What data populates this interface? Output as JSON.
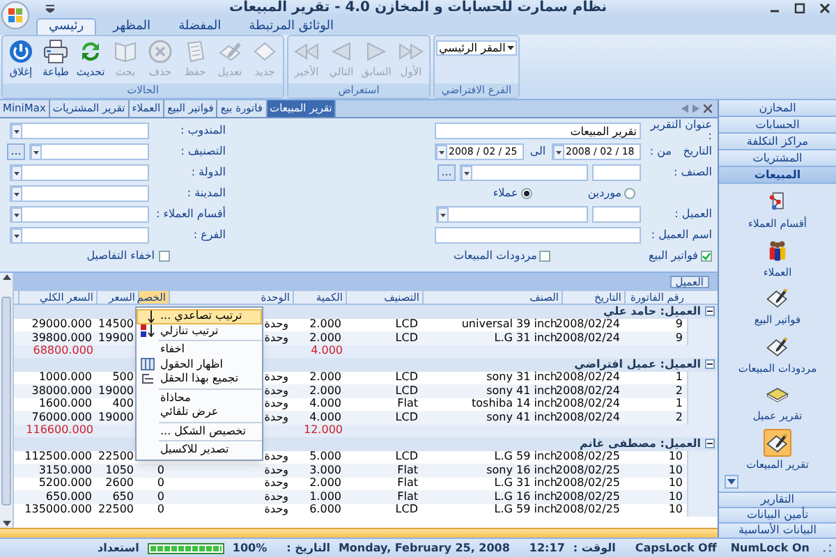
{
  "window": {
    "title": "نظام سمارت للحسابات و المخازن 4.0 - تقرير المبيعات"
  },
  "ribbon": {
    "tabs": [
      {
        "label": "الوثائق المرتبطة",
        "selected": false
      },
      {
        "label": "المفضلة",
        "selected": false
      },
      {
        "label": "المظهر",
        "selected": false
      },
      {
        "label": "رئيسي",
        "selected": true
      }
    ],
    "groups": [
      {
        "kind": "dropdown",
        "title": "الفرع الافتراضي",
        "value": "المقر الرئيسي"
      },
      {
        "kind": "buttons",
        "title": "استعراض",
        "buttons": [
          {
            "kind": "first",
            "label": "الأول",
            "disabled": true
          },
          {
            "kind": "previous",
            "label": "السابق",
            "disabled": true
          },
          {
            "kind": "next",
            "label": "التالي",
            "disabled": true
          },
          {
            "kind": "last",
            "label": "الأخير",
            "disabled": true
          }
        ]
      },
      {
        "kind": "buttons",
        "title": "الحالات",
        "buttons": [
          {
            "kind": "new",
            "label": "جديد",
            "disabled": true
          },
          {
            "kind": "edit",
            "label": "تعديل",
            "disabled": true
          },
          {
            "kind": "save",
            "label": "حفظ",
            "disabled": true
          },
          {
            "kind": "delete",
            "label": "حذف",
            "disabled": true
          },
          {
            "kind": "search",
            "label": "بحث",
            "disabled": true
          },
          {
            "kind": "refresh",
            "label": "تحديث",
            "disabled": false
          },
          {
            "kind": "print",
            "label": "طباعة",
            "disabled": false
          },
          {
            "kind": "power",
            "label": "إغلاق",
            "disabled": false
          }
        ]
      }
    ]
  },
  "document_tabs": [
    {
      "label": "تقرير المبيعات",
      "selected": true
    },
    {
      "label": "فاتورة بيع",
      "selected": false
    },
    {
      "label": "فواتير البيع",
      "selected": false
    },
    {
      "label": "العملاء",
      "selected": false
    },
    {
      "label": "تقرير المشتريات",
      "selected": false
    },
    {
      "label": "MiniMax",
      "selected": false
    }
  ],
  "form": {
    "title_field": {
      "label": "عنوان التقرير :",
      "value": "تقرير المبيعات"
    },
    "date_range": {
      "label": "التاريخ",
      "from_label": "من :",
      "from": "2008 / 02 / 18",
      "to_label": "الى",
      "to": "2008 / 02 / 25"
    },
    "item_field": {
      "label": "الصنف :",
      "button": "..."
    },
    "party": [
      {
        "label": "موردين",
        "selected": false
      },
      {
        "label": "عملاء",
        "selected": true
      }
    ],
    "customer_field": {
      "label": "العميل :"
    },
    "customer_name_field": {
      "label": "اسم العميل :"
    },
    "invoice_types": [
      {
        "label": "فواتير البيع",
        "checked": true
      },
      {
        "label": "مردودات المبيعات",
        "checked": false
      }
    ],
    "left_fields": [
      {
        "label": "المندوب :"
      },
      {
        "label": "التصنيف :",
        "button": "..."
      },
      {
        "label": "الدولة :"
      },
      {
        "label": "المدينة :"
      },
      {
        "label": "أقسام العملاء :"
      },
      {
        "label": "الفرع :"
      }
    ],
    "hide_details": {
      "label": "اخفاء التفاصيل",
      "checked": false
    }
  },
  "grid": {
    "group_by": "العميل",
    "columns": [
      {
        "label": "رقم الفاتورة",
        "selected": false
      },
      {
        "label": "التاريخ",
        "selected": false
      },
      {
        "label": "الصنف",
        "selected": false
      },
      {
        "label": "التصنيف",
        "selected": false
      },
      {
        "label": "الكمية",
        "selected": false
      },
      {
        "label": "الوحدة",
        "selected": false
      },
      {
        "label": "الخصم",
        "selected": true
      },
      {
        "label": "السعر",
        "selected": false
      },
      {
        "label": "السعر الكلي",
        "selected": false
      }
    ],
    "groups": [
      {
        "title": "العميل: حامد علي",
        "expanded": true,
        "rows": [
          {
            "invoice": "9",
            "date": "2008/02/24",
            "item": "universal 39 inch",
            "category": "LCD",
            "qty": "2.000",
            "unit": "وحدة",
            "price": "14500",
            "total": "29000.000"
          },
          {
            "invoice": "9",
            "date": "2008/02/24",
            "item": "L.G 31 inch",
            "category": "LCD",
            "qty": "2.000",
            "unit": "وحدة",
            "price": "19900",
            "total": "39800.000"
          }
        ],
        "summary": {
          "qty": "4.000",
          "total": "68800.000"
        }
      },
      {
        "title": "العميل: عميل افتراضي",
        "expanded": true,
        "rows": [
          {
            "invoice": "1",
            "date": "2008/02/24",
            "item": "sony 31 inch",
            "category": "LCD",
            "qty": "2.000",
            "unit": "وحدة",
            "price": "500",
            "total": "1000.000"
          },
          {
            "invoice": "2",
            "date": "2008/02/24",
            "item": "sony 41 inch",
            "category": "LCD",
            "qty": "2.000",
            "unit": "وحدة",
            "price": "19000",
            "total": "38000.000"
          },
          {
            "invoice": "1",
            "date": "2008/02/24",
            "item": "toshiba 14 inch",
            "category": "Flat",
            "qty": "4.000",
            "unit": "وحدة",
            "price": "400",
            "total": "1600.000"
          },
          {
            "invoice": "2",
            "date": "2008/02/24",
            "item": "sony 41 inch",
            "category": "LCD",
            "qty": "4.000",
            "unit": "وحدة",
            "price": "19000",
            "total": "76000.000"
          }
        ],
        "summary": {
          "qty": "12.000",
          "total": "116600.000"
        }
      },
      {
        "title": "العميل: مصطفى غانم",
        "expanded": true,
        "rows": [
          {
            "invoice": "10",
            "date": "2008/02/25",
            "item": "L.G 59 inch",
            "category": "LCD",
            "qty": "5.000",
            "unit": "وحدة",
            "price": "22500",
            "total": "112500.000"
          },
          {
            "invoice": "10",
            "date": "2008/02/25",
            "item": "sony 16 inch",
            "category": "Flat",
            "qty": "3.000",
            "unit": "وحدة",
            "discount": "0",
            "price": "1050",
            "total": "3150.000"
          },
          {
            "invoice": "10",
            "date": "2008/02/25",
            "item": "L.G 31 inch",
            "category": "Flat",
            "qty": "2.000",
            "unit": "وحدة",
            "discount": "0",
            "price": "2600",
            "total": "5200.000"
          },
          {
            "invoice": "10",
            "date": "2008/02/25",
            "item": "L.G 16 inch",
            "category": "Flat",
            "qty": "1.000",
            "unit": "وحدة",
            "discount": "0",
            "price": "650",
            "total": "650.000"
          },
          {
            "invoice": "10",
            "date": "2008/02/25",
            "item": "L.G 59 inch",
            "category": "LCD",
            "qty": "6.000",
            "unit": "وحدة",
            "discount": "0",
            "price": "22500",
            "total": "135000.000"
          }
        ]
      }
    ]
  },
  "context_menu": {
    "items": [
      {
        "kind": "sort_ascending",
        "label": "ترتيب تصاعدي ...",
        "selected": true
      },
      {
        "kind": "sort_descending",
        "label": "ترتيب تنازلي",
        "selected": false
      },
      {
        "kind": "separator"
      },
      {
        "kind": "plain",
        "label": "اخفاء",
        "selected": false
      },
      {
        "kind": "columns",
        "label": "اظهار الحقول",
        "selected": false
      },
      {
        "kind": "group",
        "label": "تجميع بهذا الحقل",
        "selected": false
      },
      {
        "kind": "separator"
      },
      {
        "kind": "plain",
        "label": "محاذاة",
        "selected": false
      },
      {
        "kind": "plain",
        "label": "عرض تلقائي",
        "selected": false
      },
      {
        "kind": "separator"
      },
      {
        "kind": "plain",
        "label": "تخصيص الشكل ...",
        "selected": false
      },
      {
        "kind": "separator"
      },
      {
        "kind": "plain",
        "label": "تصدير للاكسيل",
        "selected": false
      }
    ]
  },
  "navigation": {
    "sections": [
      {
        "label": "المخازن",
        "selected": false
      },
      {
        "label": "الحسابات",
        "selected": false
      },
      {
        "label": "مراكز التكلفة",
        "selected": false
      },
      {
        "label": "المشتريات",
        "selected": false
      },
      {
        "label": "المبيعات",
        "selected": true
      }
    ],
    "items": [
      {
        "kind": "diagram",
        "label": "أقسام العملاء",
        "selected": false
      },
      {
        "kind": "people",
        "label": "العملاء",
        "selected": false
      },
      {
        "kind": "note",
        "label": "فواتير البيع",
        "selected": false
      },
      {
        "kind": "note",
        "label": "مردودات المبيعات",
        "selected": false
      },
      {
        "kind": "book",
        "label": "تقرير عميل",
        "selected": false
      },
      {
        "kind": "note",
        "label": "تقرير المبيعات",
        "selected": true
      }
    ],
    "bottom": [
      {
        "label": "التقارير"
      },
      {
        "label": "تأمين البيانات"
      },
      {
        "label": "البيانات الأساسية"
      }
    ]
  },
  "status_bar": {
    "state": "استعداد",
    "progress": {
      "level": 1,
      "reading": "100%"
    },
    "date_label": "التاريخ :",
    "date": "Monday, February 25, 2008",
    "time_label": "الوقت :",
    "time": "12:17",
    "caps": "CapsLock Off",
    "num": "NumLock On"
  }
}
